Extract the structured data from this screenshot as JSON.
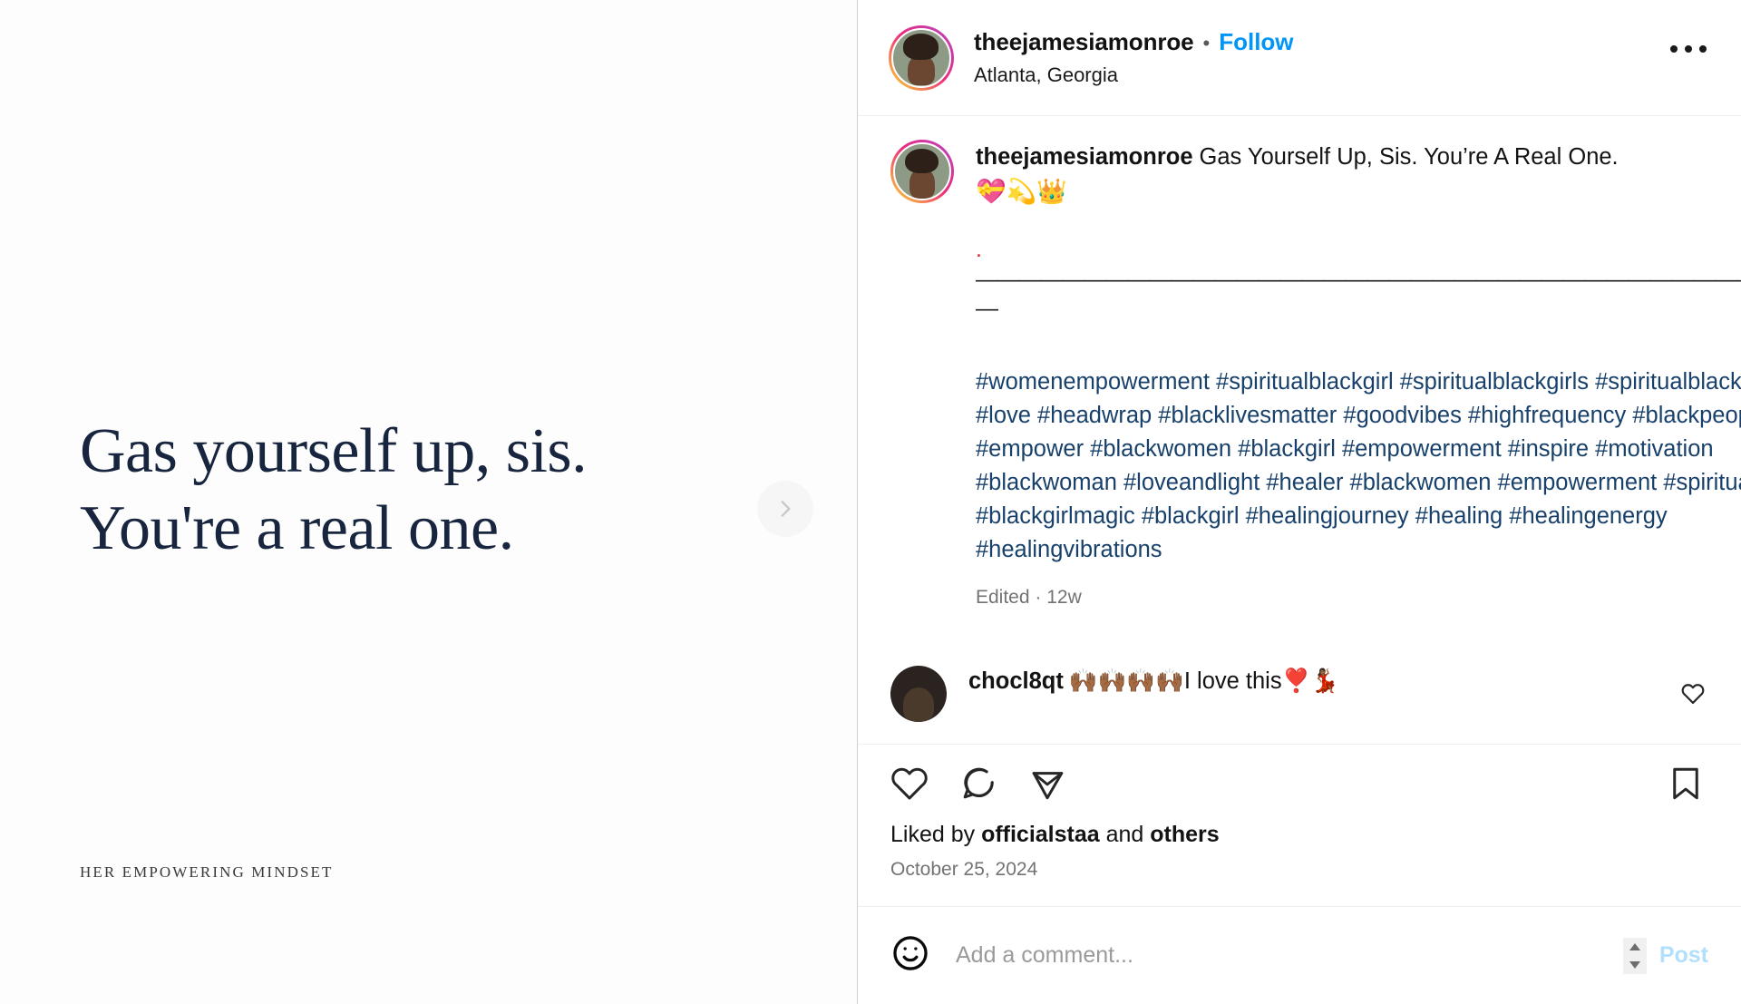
{
  "media": {
    "quote_line_1": "Gas yourself up, sis.",
    "quote_line_2": "You're a real one.",
    "brand_mark": "HER EMPOWERING MINDSET",
    "next_icon": "chevron-right-icon"
  },
  "header": {
    "username": "theejamesiamonroe",
    "separator": "•",
    "follow_label": "Follow",
    "location": "Atlanta, Georgia",
    "more_icon": "ellipsis-icon"
  },
  "caption": {
    "username": "theejamesiamonroe",
    "text": "Gas Yourself Up, Sis. You’re A Real One.",
    "emojis": "💝💫👑",
    "rule": "————————————————————————————————————————",
    "rule_tail": "—",
    "hashtags": "#womenempowerment #spiritualblackgirl #spiritualblackgirls #spiritualblackwomen #love #headwrap #blacklivesmatter #goodvibes #highfrequency #blackpeople #empower #blackwomen #blackgirl #empowerment #inspire #motivation #blackwoman #loveandlight #healer #blackwomen #empowerment #spiritualhealer #blackgirlmagic #blackgirl #healingjourney #healing #healingenergy #healingvibrations",
    "edited_meta": "Edited · 12w"
  },
  "comments": [
    {
      "username": "chocl8qt",
      "text": "🙌🏾🙌🏾🙌🏾🙌🏾I love this❣️💃🏾",
      "like_icon": "heart-outline-icon"
    }
  ],
  "actions": {
    "like_icon": "heart-outline-icon",
    "comment_icon": "speech-bubble-icon",
    "share_icon": "paper-plane-icon",
    "save_icon": "bookmark-outline-icon"
  },
  "engagement": {
    "liked_by_prefix": "Liked by ",
    "liked_by_user": "officialstaa",
    "liked_by_middle": " and ",
    "liked_by_others": "others",
    "date": "October 25, 2024"
  },
  "composer": {
    "emoji_icon": "smiley-face-icon",
    "placeholder": "Add a comment...",
    "value": "",
    "spinner_icon": "stepper-icon",
    "post_label": "Post"
  },
  "colors": {
    "link_blue": "#0095f6",
    "hashtag_navy": "#17406b",
    "quote_navy": "#18253f",
    "muted_gray": "#737373"
  }
}
